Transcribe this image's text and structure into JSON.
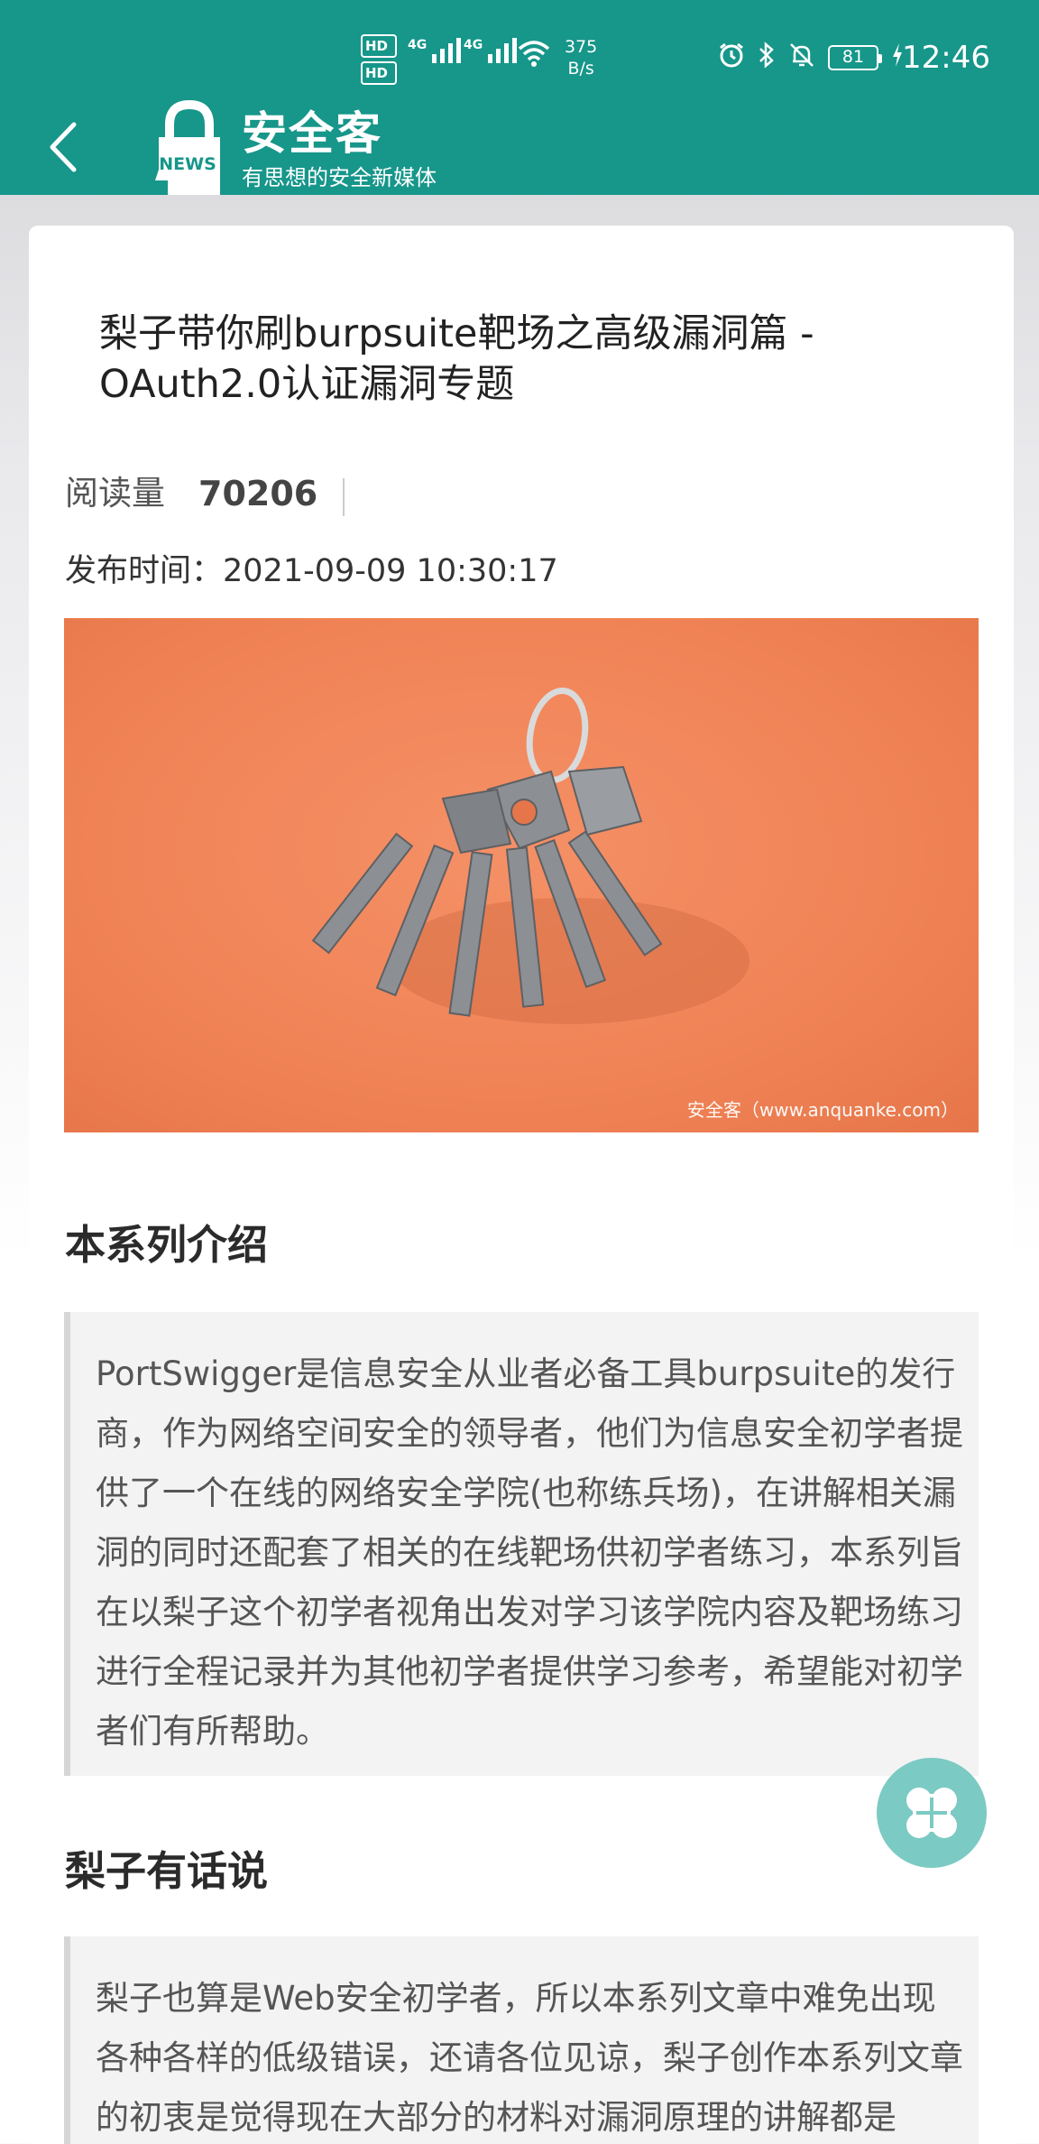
{
  "status_bar": {
    "hd1": "HD",
    "hd2": "HD",
    "net1": "4G",
    "net2": "4G",
    "speed_value": "375",
    "speed_unit": "B/s",
    "battery": "81",
    "time": "12:46"
  },
  "header": {
    "logo_badge": "NEWS",
    "brand_name": "安全客",
    "slogan": "有思想的安全新媒体"
  },
  "article": {
    "title": "梨子带你刷burpsuite靶场之高级漏洞篇 - OAuth2.0认证漏洞专题",
    "read_label": "阅读量",
    "read_count": "70206",
    "publish_label": "发布时间：",
    "publish_time": "2021-09-09 10:30:17",
    "image_watermark": "安全客（www.anquanke.com）",
    "sections": [
      {
        "heading": "本系列介绍",
        "body": "PortSwigger是信息安全从业者必备工具burpsuite的发行商，作为网络空间安全的领导者，他们为信息安全初学者提供了一个在线的网络安全学院(也称练兵场)，在讲解相关漏洞的同时还配套了相关的在线靶场供初学者练习，本系列旨在以梨子这个初学者视角出发对学习该学院内容及靶场练习进行全程记录并为其他初学者提供学习参考，希望能对初学者们有所帮助。"
      },
      {
        "heading": "梨子有话说",
        "body": "梨子也算是Web安全初学者，所以本系列文章中难免出现各种各样的低级错误，还请各位见谅，梨子创作本系列文章的初衷是觉得现在大部分的材料对漏洞原理的讲解都是"
      }
    ]
  },
  "colors": {
    "header_bg": "#17968a",
    "fab_bg": "#7bcac3",
    "hero_bg": "#f08356"
  },
  "icons": {
    "back": "chevron-left-icon",
    "fab": "four-petal-menu-icon"
  }
}
